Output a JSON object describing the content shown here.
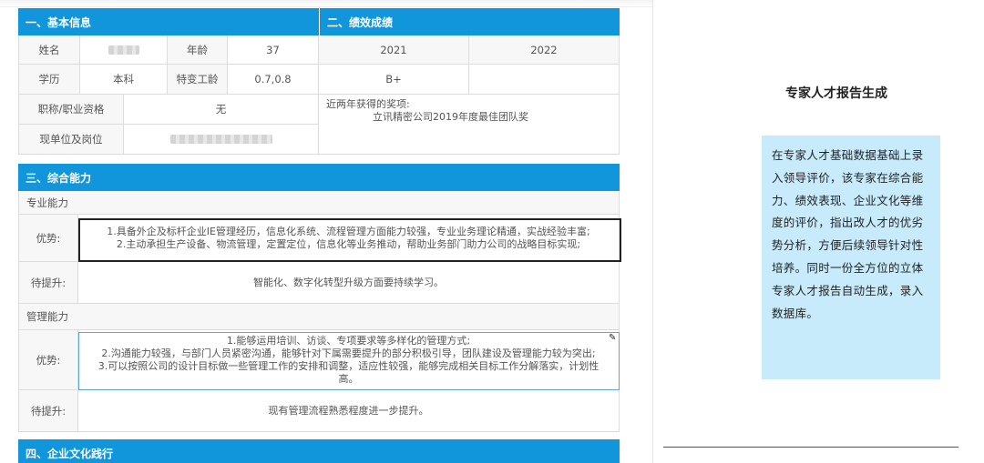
{
  "section1": {
    "title": "一、基本信息",
    "name_label": "姓名",
    "age_label": "年龄",
    "age": "37",
    "edu_label": "学历",
    "edu": "本科",
    "tech_age_label": "特变工龄",
    "tech_age": "0.7,0.8",
    "title_label": "职称/职业资格",
    "title_value": "无",
    "unit_label": "现单位及岗位"
  },
  "section2": {
    "title": "二、绩效成绩",
    "year1": "2021",
    "year2": "2022",
    "grade1": "B+",
    "grade2": "",
    "awards_label": "近两年获得的奖项:",
    "awards_value": "立讯精密公司2019年度最佳团队奖"
  },
  "section3": {
    "title": "三、综合能力",
    "prof_label": "专业能力",
    "adv_label": "优势:",
    "prof_adv_line1": "1.具备外企及标杆企业IE管理经历，信息化系统、流程管理方面能力较强，专业业务理论精通，实战经验丰富;",
    "prof_adv_line2": "2.主动承担生产设备、物流管理，定置定位，信息化等业务推动，帮助业务部门助力公司的战略目标实现;",
    "improve_label": "待提升:",
    "prof_improve": "智能化、数字化转型升级方面要持续学习。",
    "mgmt_label": "管理能力",
    "mgmt_adv_line1": "1.能够运用培训、访谈、专项要求等多样化的管理方式;",
    "mgmt_adv_line2": "2.沟通能力较强，与部门人员紧密沟通，能够针对下属需要提升的部分积极引导，团队建设及管理能力较为突出;",
    "mgmt_adv_line3": "3.可以按照公司的设计目标做一些管理工作的安排和调整，适应性较强，能够完成相关目标工作分解落实，计划性",
    "mgmt_adv_line4": "高。",
    "mgmt_improve": "现有管理流程熟悉程度进一步提升。"
  },
  "section4": {
    "title": "四、企业文化践行"
  },
  "panel": {
    "title": "专家人才报告生成",
    "description": "在专家人才基础数据基础上录入领导评价，该专家在综合能力、绩效表现、企业文化等维度的评价，指出改人才的优劣势分析，方便后续领导针对性培养。同时一份全方位的立体专家人才报告自动生成，录入数据库。"
  },
  "colors": {
    "header_blue": "#1296db",
    "panel_bg": "#c7ebfb"
  }
}
